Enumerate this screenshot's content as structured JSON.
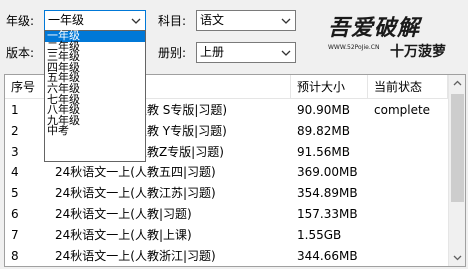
{
  "filters": {
    "grade_label": "年级:",
    "grade_value": "一年级",
    "subject_label": "科目:",
    "subject_value": "语文",
    "version_label": "版本:",
    "volume_label": "册别:",
    "volume_value": "上册"
  },
  "grade_dropdown": {
    "options": [
      "一年级",
      "二年级",
      "三年级",
      "四年级",
      "五年级",
      "六年级",
      "七年级",
      "八年级",
      "九年级",
      "中考"
    ],
    "selected_index": 0
  },
  "logo": {
    "main": "吾爱破解",
    "url": "WWW.52PoJie.CN",
    "slogan": "十万菠萝"
  },
  "table": {
    "columns": [
      "序号",
      "",
      "预计大小",
      "当前状态"
    ],
    "rows": [
      {
        "no": "1",
        "name": "24秋语文一上(人教 S专版|习题)",
        "size": "90.90MB",
        "status": "complete"
      },
      {
        "no": "2",
        "name": "24秋语文一上(人教 Y专版|习题)",
        "size": "89.82MB",
        "status": ""
      },
      {
        "no": "3",
        "name": "24秋语文一上(人教Z专版|习题)",
        "size": "91.56MB",
        "status": ""
      },
      {
        "no": "4",
        "name": "24秋语文一上(人教五四|习题)",
        "size": "369.00MB",
        "status": ""
      },
      {
        "no": "5",
        "name": "24秋语文一上(人教江苏|习题)",
        "size": "354.89MB",
        "status": ""
      },
      {
        "no": "6",
        "name": "24秋语文一上(人教|习题)",
        "size": "157.33MB",
        "status": ""
      },
      {
        "no": "7",
        "name": "24秋语文一上(人教|上课)",
        "size": "1.55GB",
        "status": ""
      },
      {
        "no": "8",
        "name": "24秋语文一上(人教浙江|习题)",
        "size": "344.66MB",
        "status": ""
      }
    ]
  }
}
